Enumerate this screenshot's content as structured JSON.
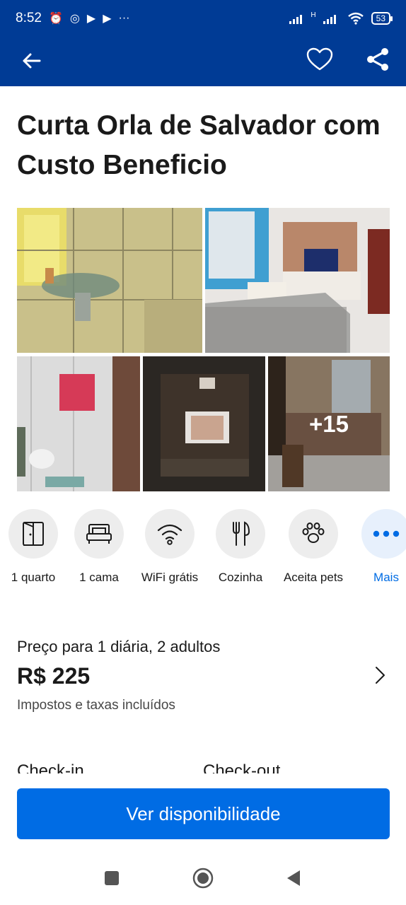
{
  "status_bar": {
    "time": "8:52",
    "left_icons": [
      "alarm-icon",
      "instagram-icon",
      "play-icon",
      "play-icon",
      "more-dots"
    ],
    "more": "···",
    "network": "H",
    "battery": "53"
  },
  "app_bar": {
    "back_icon": "arrow-left-icon",
    "favorite_icon": "heart-icon",
    "share_icon": "share-icon",
    "color": "#003b95"
  },
  "property": {
    "title": "Curta Orla de Salvador com Custo Beneficio"
  },
  "gallery": {
    "more_photos_label": "+15"
  },
  "facilities": [
    {
      "label": "1 quarto",
      "icon": "door-icon"
    },
    {
      "label": "1 cama",
      "icon": "bed-icon"
    },
    {
      "label": "WiFi grátis",
      "icon": "wifi-icon"
    },
    {
      "label": "Cozinha",
      "icon": "utensils-icon"
    },
    {
      "label": "Aceita pets",
      "icon": "paw-icon"
    },
    {
      "label": "Mais",
      "icon": "more-icon"
    }
  ],
  "price": {
    "caption": "Preço para 1 diária, 2 adultos",
    "value": "R$ 225",
    "taxes": "Impostos e taxas incluídos"
  },
  "dates": {
    "checkin_label": "Check-in",
    "checkout_label": "Check-out"
  },
  "cta": {
    "label": "Ver disponibilidade",
    "color": "#006ce4"
  },
  "nav_bar": {
    "icons": [
      "square-icon",
      "home-circle-icon",
      "back-triangle-icon"
    ]
  }
}
